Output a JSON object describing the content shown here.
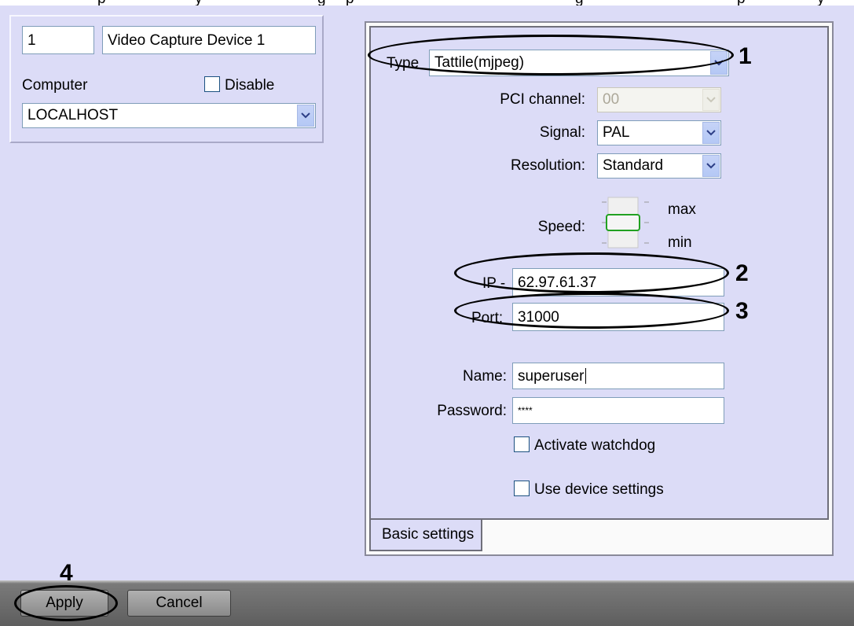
{
  "top_cut_text": [
    "p",
    "y",
    "g",
    "p",
    "g",
    "p",
    "y"
  ],
  "device": {
    "number": "1",
    "name": "Video Capture Device 1",
    "computer_label": "Computer",
    "disable_label": "Disable",
    "computer_value": "LOCALHOST"
  },
  "settings": {
    "type_label": "Type",
    "type_value": "Tattile(mjpeg)",
    "pci_label": "PCI channel:",
    "pci_value": "00",
    "signal_label": "Signal:",
    "signal_value": "PAL",
    "resolution_label": "Resolution:",
    "resolution_value": "Standard",
    "speed_label": "Speed:",
    "speed_max": "max",
    "speed_min": "min",
    "speed_level": 0.5,
    "ip_label": "IP -",
    "ip_value": "62.97.61.37",
    "port_label": "Port:",
    "port_value": "31000",
    "name_label": "Name:",
    "name_value": "superuser",
    "password_label": "Password:",
    "password_value": "****",
    "watchdog_label": "Activate watchdog",
    "use_device_label": "Use device settings",
    "tab_label": "Basic settings"
  },
  "callouts": [
    "1",
    "2",
    "3",
    "4"
  ],
  "buttons": {
    "apply": "Apply",
    "cancel": "Cancel"
  },
  "colors": {
    "panel_bg": "#dcdcf7",
    "bottom_bar": "#6a6a6a"
  }
}
